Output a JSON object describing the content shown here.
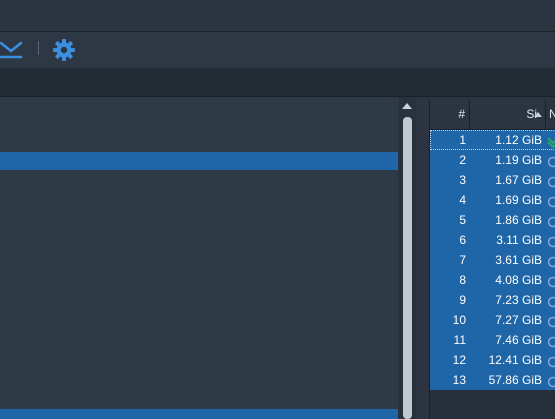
{
  "toolbar": {
    "icons": [
      "download-icon",
      "gear-icon"
    ]
  },
  "colors": {
    "accent": "#3b8fe0",
    "selection": "#1f66a8",
    "status_done": "#2ea36a",
    "status_pending": "#7fa8d6"
  },
  "table": {
    "columns": {
      "number": "#",
      "size": "Si",
      "name": "N"
    },
    "rows": [
      {
        "number": "1",
        "size": "1.12 GiB",
        "status": "done"
      },
      {
        "number": "2",
        "size": "1.19 GiB",
        "status": "pending"
      },
      {
        "number": "3",
        "size": "1.67 GiB",
        "status": "pending"
      },
      {
        "number": "4",
        "size": "1.69 GiB",
        "status": "pending"
      },
      {
        "number": "5",
        "size": "1.86 GiB",
        "status": "pending"
      },
      {
        "number": "6",
        "size": "3.11 GiB",
        "status": "pending"
      },
      {
        "number": "7",
        "size": "3.61 GiB",
        "status": "pending"
      },
      {
        "number": "8",
        "size": "4.08 GiB",
        "status": "pending"
      },
      {
        "number": "9",
        "size": "7.23 GiB",
        "status": "pending"
      },
      {
        "number": "10",
        "size": "7.27 GiB",
        "status": "pending"
      },
      {
        "number": "11",
        "size": "7.46 GiB",
        "status": "pending"
      },
      {
        "number": "12",
        "size": "12.41 GiB",
        "status": "pending"
      },
      {
        "number": "13",
        "size": "57.86 GiB",
        "status": "pending"
      }
    ]
  }
}
